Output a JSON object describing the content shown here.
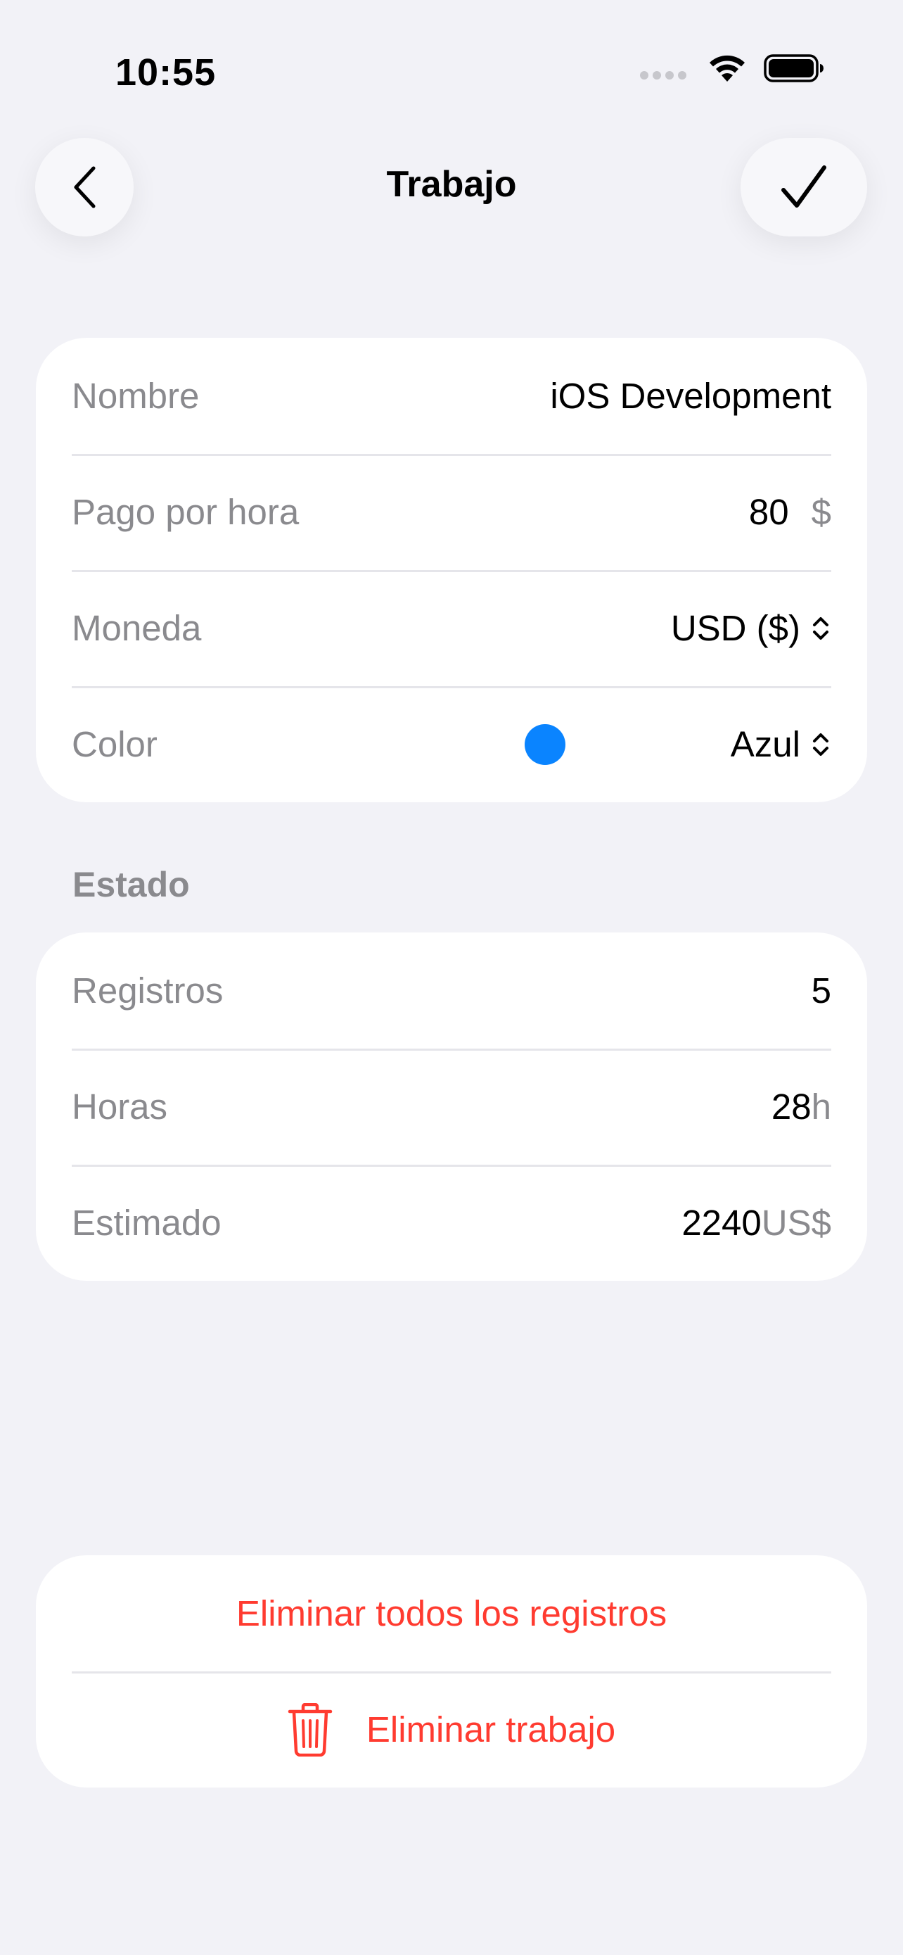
{
  "status_bar": {
    "time": "10:55",
    "icons": [
      "cellular-icon",
      "wifi-icon",
      "battery-icon"
    ]
  },
  "nav": {
    "title": "Trabajo",
    "back_icon": "chevron-left-icon",
    "done_icon": "checkmark-icon"
  },
  "job_form": {
    "name_label": "Nombre",
    "name_value": "iOS Development",
    "rate_label": "Pago por hora",
    "rate_value": "80",
    "rate_unit": "$",
    "currency_label": "Moneda",
    "currency_value": "USD ($)",
    "color_label": "Color",
    "color_value": "Azul",
    "color_swatch": "#0A84FF"
  },
  "stats": {
    "section_title": "Estado",
    "records_label": "Registros",
    "records_value": "5",
    "hours_label": "Horas",
    "hours_value": "28",
    "hours_unit": "h",
    "estimate_label": "Estimado",
    "estimate_value": "2240",
    "estimate_unit": "US$"
  },
  "danger": {
    "delete_records_label": "Eliminar todos los registros",
    "delete_job_label": "Eliminar trabajo",
    "delete_job_icon": "trash-icon"
  },
  "colors": {
    "background": "#F2F2F7",
    "card": "#FFFFFF",
    "secondary_text": "#8A8A8E",
    "destructive": "#FF3B30",
    "accent": "#0A84FF"
  }
}
